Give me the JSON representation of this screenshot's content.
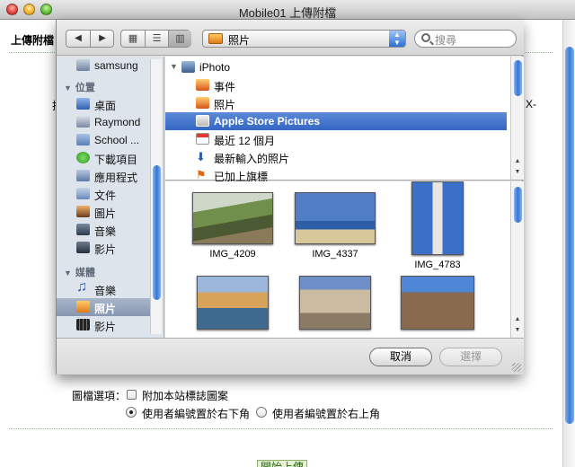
{
  "window": {
    "title": "Mobile01 上傳附檔"
  },
  "page": {
    "heading": "上傳附檔",
    "fragment_left": "搜",
    "fragment_right": "X-",
    "options_label": "圖檔選項：",
    "watermark_option": "附加本站標誌圖案",
    "position_bottom_right": "使用者編號置於右下角",
    "position_top_right": "使用者編號置於右上角",
    "upload_button": "開始上傳"
  },
  "dialog": {
    "location": "照片",
    "search_placeholder": "搜尋",
    "sidebar": {
      "top_item": "samsung",
      "places_header": "位置",
      "places": [
        {
          "label": "桌面",
          "icon": "desktop-icon"
        },
        {
          "label": "Raymond",
          "icon": "home-icon"
        },
        {
          "label": "School ...",
          "icon": "folder-icon"
        },
        {
          "label": "下載項目",
          "icon": "downloads-icon"
        },
        {
          "label": "應用程式",
          "icon": "applications-icon"
        },
        {
          "label": "文件",
          "icon": "documents-icon"
        },
        {
          "label": "圖片",
          "icon": "pictures-icon"
        },
        {
          "label": "音樂",
          "icon": "music-icon"
        },
        {
          "label": "影片",
          "icon": "movies-icon"
        }
      ],
      "media_header": "媒體",
      "media": [
        {
          "label": "音樂",
          "icon": "music-note-icon"
        },
        {
          "label": "照片",
          "icon": "photos-icon",
          "selected": true
        },
        {
          "label": "影片",
          "icon": "film-icon"
        }
      ]
    },
    "sources": [
      {
        "label": "iPhoto",
        "icon": "iphoto-icon"
      },
      {
        "label": "事件",
        "icon": "events-icon"
      },
      {
        "label": "照片",
        "icon": "photos-icon"
      },
      {
        "label": "Apple Store Pictures",
        "icon": "album-icon",
        "selected": true
      },
      {
        "label": "最近 12 個月",
        "icon": "calendar-icon"
      },
      {
        "label": "最新輸入的照片",
        "icon": "import-icon"
      },
      {
        "label": "已加上旗標",
        "icon": "flag-icon"
      }
    ],
    "photos": [
      {
        "caption": "IMG_4209"
      },
      {
        "caption": "IMG_4337"
      },
      {
        "caption": "IMG_4783"
      },
      {
        "caption": ""
      },
      {
        "caption": ""
      },
      {
        "caption": ""
      }
    ],
    "cancel_button": "取消",
    "choose_button": "選擇"
  },
  "colors": {
    "selection_blue": "#3467c4",
    "sidebar_bg": "#dde4ec",
    "upload_button_bg": "#e6f3d2"
  }
}
